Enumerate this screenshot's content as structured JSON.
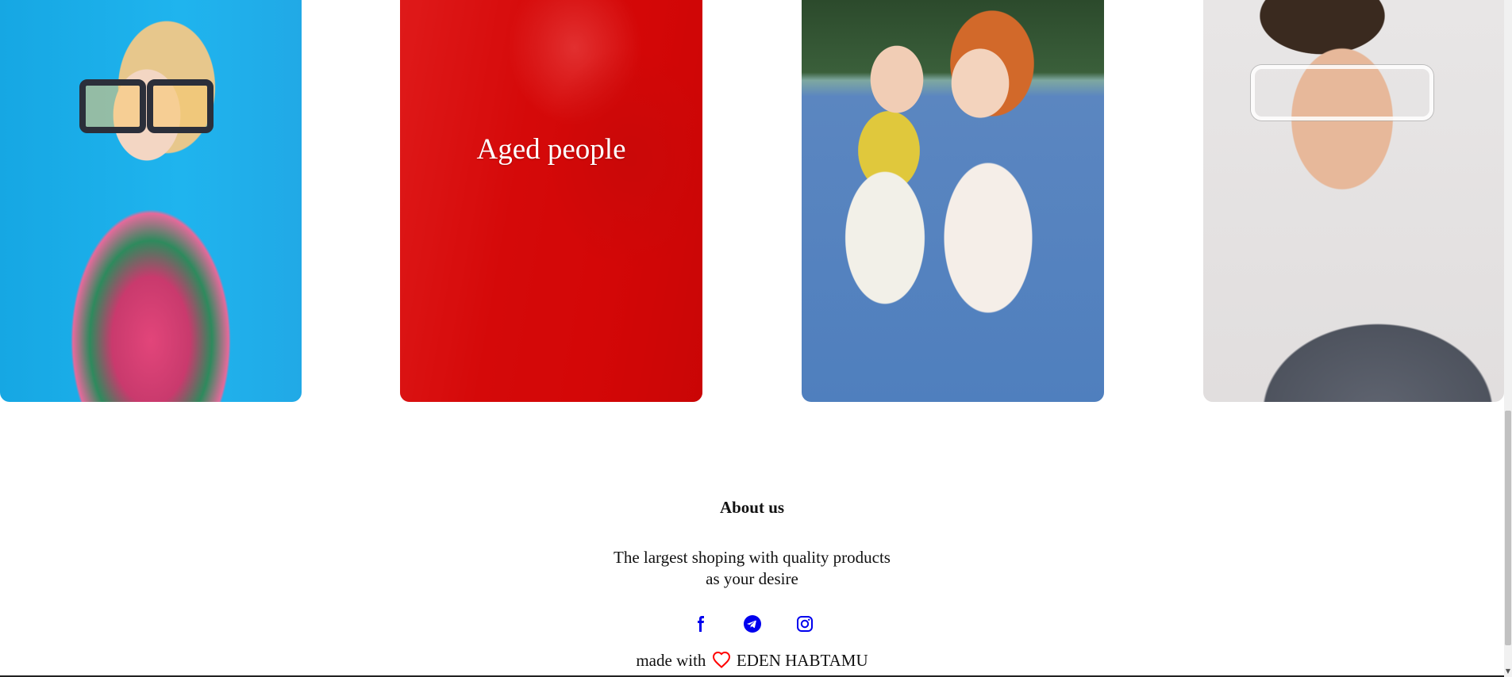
{
  "cards": [
    {
      "id": "woman",
      "title": ""
    },
    {
      "id": "aged",
      "title": "Aged people"
    },
    {
      "id": "kids",
      "title": ""
    },
    {
      "id": "man",
      "title": ""
    }
  ],
  "about": {
    "title": "About us",
    "text_line1": "The largest shoping with quality products",
    "text_line2": "as your desire"
  },
  "socials": [
    {
      "icon": "facebook-icon"
    },
    {
      "icon": "telegram-icon"
    },
    {
      "icon": "instagram-icon"
    }
  ],
  "footer": {
    "made_prefix": "made with",
    "author": "EDEN HABTAMU"
  },
  "colors": {
    "social_blue": "#0000ee",
    "heart_red": "#ff0000",
    "aged_overlay": "#dd0000"
  }
}
